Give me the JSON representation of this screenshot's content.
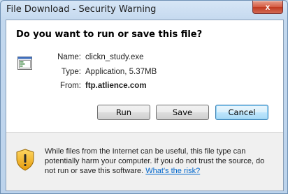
{
  "window": {
    "title": "File Download - Security Warning",
    "close_glyph": "x"
  },
  "dialog": {
    "question": "Do you want to run or save this file?",
    "file_icon": "executable-file-icon",
    "fields": {
      "name_label": "Name:",
      "name_value": "clickn_study.exe",
      "type_label": "Type:",
      "type_value": "Application, 5.37MB",
      "from_label": "From:",
      "from_value": "ftp.atlience.com"
    },
    "buttons": {
      "run": "Run",
      "save": "Save",
      "cancel": "Cancel"
    },
    "warning": {
      "icon": "warning-shield-icon",
      "text": "While files from the Internet can be useful, this file type can potentially harm your computer. If you do not trust the source, do not run or save this software.",
      "link": "What's the risk?"
    }
  },
  "colors": {
    "link": "#0066cc",
    "shield": "#f2b31b",
    "close_button": "#c0391f"
  }
}
